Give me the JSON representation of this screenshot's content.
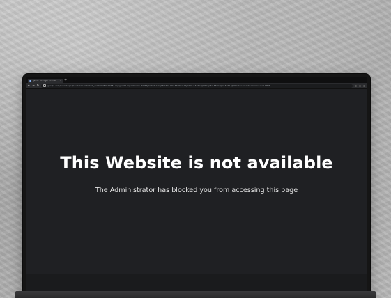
{
  "browser": {
    "tab_title": "ghost - Google Search",
    "tab_close": "×",
    "new_tab": "+",
    "url": "google.com/search?q=ghost&rlz=1C1GCEA_enUS1048US1048&oq=ghost&aqs=chrome..69i57j0i433i512l2j46i131i199i433i465i512j0i131i433i512j0i512j46i433i512j0i433i512j0i512&sourceid=chrome&ie=UTF-8",
    "back_icon": "←",
    "forward_icon": "→",
    "reload_icon": "↻"
  },
  "page": {
    "headline": "This Website is not available",
    "message": "The Administrator has blocked you from accessing this page"
  }
}
